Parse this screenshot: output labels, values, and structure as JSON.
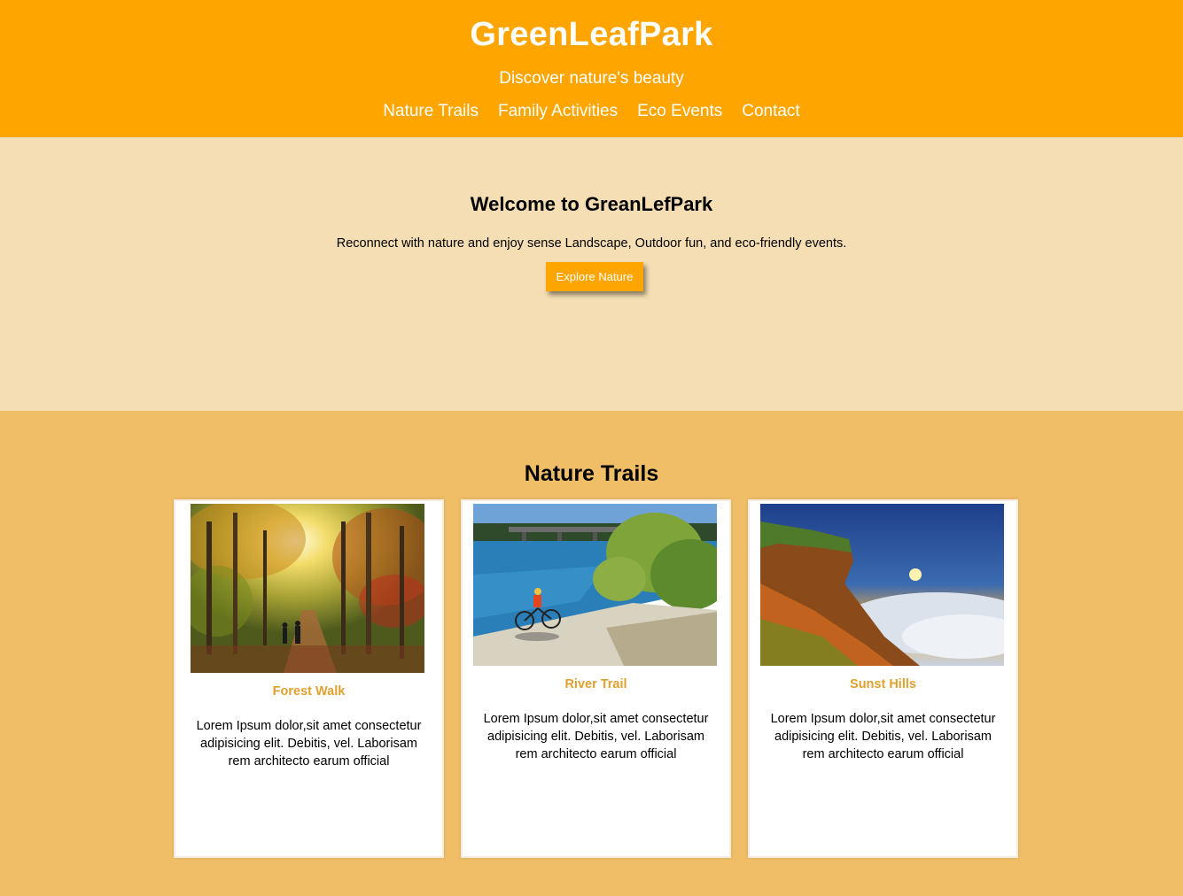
{
  "header": {
    "title": "GreenLeafPark",
    "tagline": "Discover nature's beauty",
    "nav": [
      "Nature Trails",
      "Family Activities",
      "Eco Events",
      "Contact"
    ]
  },
  "hero": {
    "heading": "Welcome to GreanLefPark",
    "text": "Reconnect with nature and enjoy sense Landscape, Outdoor fun, and eco-friendly events.",
    "button_label": "Explore Nature"
  },
  "trails": {
    "heading": "Nature Trails",
    "cards": [
      {
        "title": "Forest Walk",
        "text": "Lorem Ipsum dolor,sit amet consectetur adipisicing elit. Debitis, vel. Laborisam rem architecto earum official",
        "image": "autumn-forest-path-photo"
      },
      {
        "title": "River Trail",
        "text": "Lorem Ipsum dolor,sit amet consectetur adipisicing elit. Debitis, vel. Laborisam rem architecto earum official",
        "image": "river-cyclist-photo"
      },
      {
        "title": "Sunst Hills",
        "text": "Lorem Ipsum dolor,sit amet consectetur adipisicing elit. Debitis, vel. Laborisam rem architecto earum official",
        "image": "hill-sunset-photo"
      }
    ]
  },
  "colors": {
    "header_bg": "#ffa500",
    "hero_bg": "#f5deb3",
    "trails_bg": "#f0be67",
    "card_title": "#e0a030"
  }
}
